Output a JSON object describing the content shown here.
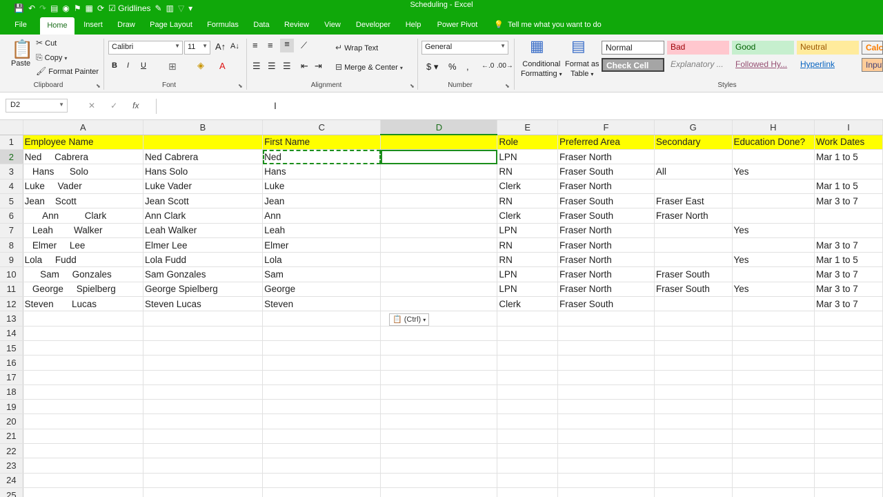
{
  "titlebar": {
    "title": "Scheduling  -  Excel",
    "gridlines_label": "Gridlines"
  },
  "tabs": [
    {
      "label": "File"
    },
    {
      "label": "Home"
    },
    {
      "label": "Insert"
    },
    {
      "label": "Draw"
    },
    {
      "label": "Page Layout"
    },
    {
      "label": "Formulas"
    },
    {
      "label": "Data"
    },
    {
      "label": "Review"
    },
    {
      "label": "View"
    },
    {
      "label": "Developer"
    },
    {
      "label": "Help"
    },
    {
      "label": "Power Pivot"
    },
    {
      "label": "Tell me what you want to do"
    }
  ],
  "ribbon": {
    "clipboard": {
      "paste": "Paste",
      "cut": "Cut",
      "copy": "Copy",
      "format_painter": "Format Painter",
      "label": "Clipboard"
    },
    "font": {
      "name": "Calibri",
      "size": "11",
      "label": "Font"
    },
    "alignment": {
      "wrap": "Wrap Text",
      "merge": "Merge & Center",
      "label": "Alignment"
    },
    "number": {
      "format": "General",
      "label": "Number"
    },
    "styles_group": {
      "conditional": "Conditional",
      "formatting": "Formatting",
      "format_as": "Format as",
      "table": "Table",
      "label": "Styles",
      "cells": [
        {
          "label": "Normal"
        },
        {
          "label": "Bad"
        },
        {
          "label": "Good"
        },
        {
          "label": "Neutral"
        },
        {
          "label": "Calcu"
        },
        {
          "label": "Check Cell"
        },
        {
          "label": "Explanatory ..."
        },
        {
          "label": "Followed Hy..."
        },
        {
          "label": "Hyperlink"
        },
        {
          "label": "Input"
        }
      ]
    }
  },
  "formula_bar": {
    "name_box": "D2",
    "fx": "fx",
    "formula": ""
  },
  "columns": [
    "A",
    "B",
    "C",
    "D",
    "E",
    "F",
    "G",
    "H",
    "I"
  ],
  "rows": [
    {
      "n": "1",
      "cells": [
        "Employee Name",
        "",
        "First Name",
        "",
        "Role",
        "Preferred Area",
        "Secondary",
        "Education Done?",
        "Work Dates"
      ]
    },
    {
      "n": "2",
      "cells": [
        "Ned     Cabrera",
        "Ned Cabrera",
        "Ned",
        "",
        "LPN",
        "Fraser North",
        "",
        "",
        "Mar 1 to 5"
      ]
    },
    {
      "n": "3",
      "cells": [
        "   Hans      Solo",
        "Hans Solo",
        "Hans",
        "",
        "RN",
        "Fraser South",
        "All",
        "Yes",
        ""
      ]
    },
    {
      "n": "4",
      "cells": [
        "Luke     Vader",
        "Luke Vader",
        "Luke",
        "",
        "Clerk",
        "Fraser North",
        "",
        "",
        "Mar 1 to 5"
      ]
    },
    {
      "n": "5",
      "cells": [
        "Jean    Scott",
        "Jean Scott",
        "Jean",
        "",
        "RN",
        "Fraser South",
        "Fraser East",
        "",
        "Mar 3 to 7"
      ]
    },
    {
      "n": "6",
      "cells": [
        "       Ann          Clark",
        "Ann Clark",
        "Ann",
        "",
        "Clerk",
        "Fraser South",
        "Fraser North",
        "",
        ""
      ]
    },
    {
      "n": "7",
      "cells": [
        "   Leah        Walker",
        "Leah Walker",
        "Leah",
        "",
        "LPN",
        "Fraser North",
        "",
        "Yes",
        ""
      ]
    },
    {
      "n": "8",
      "cells": [
        "   Elmer     Lee",
        "Elmer Lee",
        "Elmer",
        "",
        "RN",
        "Fraser North",
        "",
        "",
        "Mar 3 to 7"
      ]
    },
    {
      "n": "9",
      "cells": [
        "Lola     Fudd",
        "Lola Fudd",
        "Lola",
        "",
        "RN",
        "Fraser North",
        "",
        "Yes",
        "Mar 1 to 5"
      ]
    },
    {
      "n": "10",
      "cells": [
        "      Sam     Gonzales",
        "Sam Gonzales",
        "Sam",
        "",
        "LPN",
        "Fraser North",
        "Fraser South",
        "",
        "Mar 3 to 7"
      ]
    },
    {
      "n": "11",
      "cells": [
        "   George     Spielberg",
        "George Spielberg",
        "George",
        "",
        "LPN",
        "Fraser North",
        "Fraser South",
        "Yes",
        "Mar 3 to 7"
      ]
    },
    {
      "n": "12",
      "cells": [
        "Steven       Lucas",
        "Steven Lucas",
        "Steven",
        "",
        "Clerk",
        "Fraser South",
        "",
        "",
        "Mar 3 to 7"
      ]
    },
    {
      "n": "13",
      "cells": [
        "",
        "",
        "",
        "",
        "",
        "",
        "",
        "",
        ""
      ]
    },
    {
      "n": "14",
      "cells": [
        "",
        "",
        "",
        "",
        "",
        "",
        "",
        "",
        ""
      ]
    },
    {
      "n": "15",
      "cells": [
        "",
        "",
        "",
        "",
        "",
        "",
        "",
        "",
        ""
      ]
    },
    {
      "n": "16",
      "cells": [
        "",
        "",
        "",
        "",
        "",
        "",
        "",
        "",
        ""
      ]
    },
    {
      "n": "17",
      "cells": [
        "",
        "",
        "",
        "",
        "",
        "",
        "",
        "",
        ""
      ]
    },
    {
      "n": "18",
      "cells": [
        "",
        "",
        "",
        "",
        "",
        "",
        "",
        "",
        ""
      ]
    },
    {
      "n": "19",
      "cells": [
        "",
        "",
        "",
        "",
        "",
        "",
        "",
        "",
        ""
      ]
    },
    {
      "n": "20",
      "cells": [
        "",
        "",
        "",
        "",
        "",
        "",
        "",
        "",
        ""
      ]
    },
    {
      "n": "21",
      "cells": [
        "",
        "",
        "",
        "",
        "",
        "",
        "",
        "",
        ""
      ]
    },
    {
      "n": "22",
      "cells": [
        "",
        "",
        "",
        "",
        "",
        "",
        "",
        "",
        ""
      ]
    },
    {
      "n": "23",
      "cells": [
        "",
        "",
        "",
        "",
        "",
        "",
        "",
        "",
        ""
      ]
    },
    {
      "n": "24",
      "cells": [
        "",
        "",
        "",
        "",
        "",
        "",
        "",
        "",
        ""
      ]
    },
    {
      "n": "25",
      "cells": [
        "",
        "",
        "",
        "",
        "",
        "",
        "",
        "",
        ""
      ]
    }
  ],
  "paste_options": {
    "label": "(Ctrl)"
  },
  "colors": {
    "accent": "#10a80a",
    "header_fill": "#ffff00"
  }
}
